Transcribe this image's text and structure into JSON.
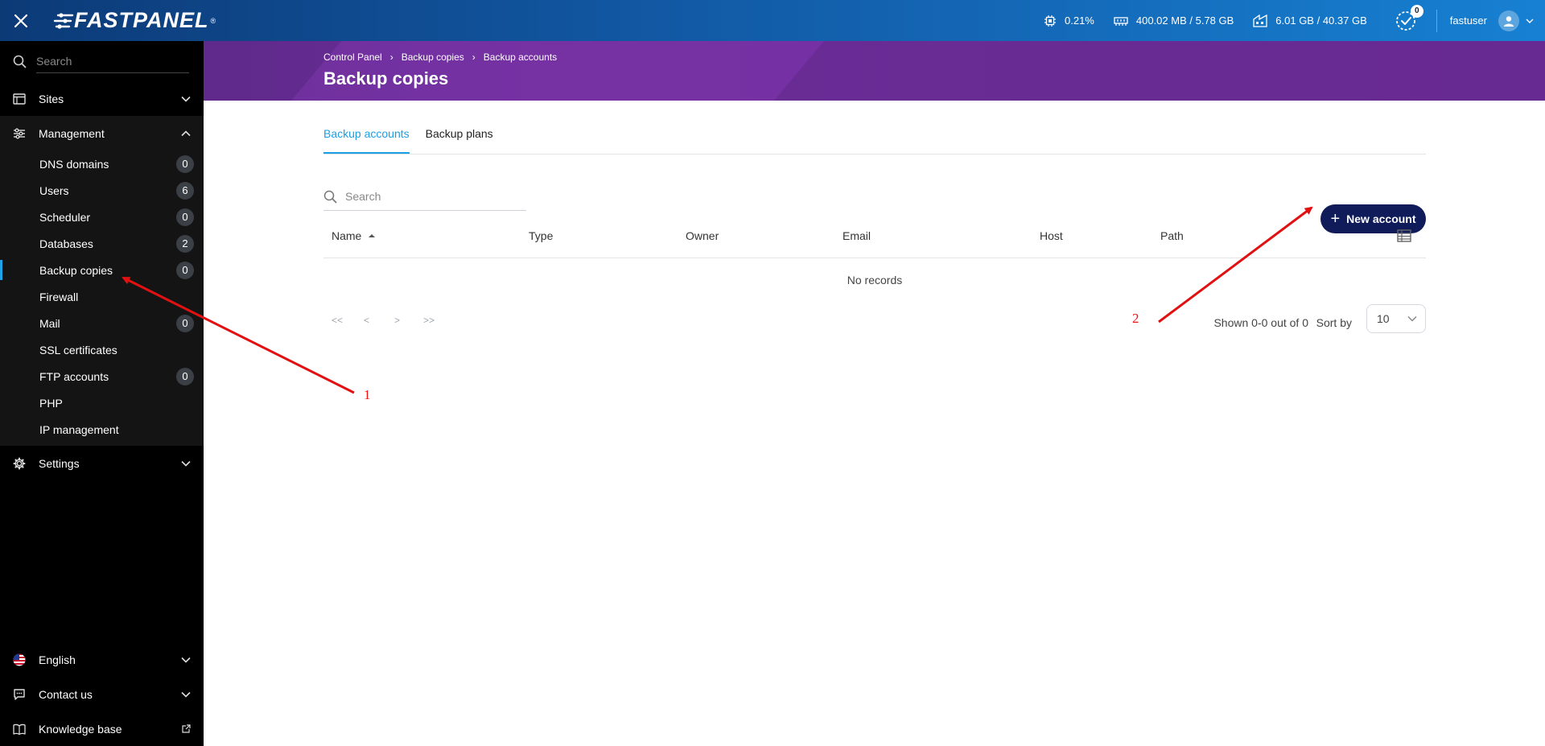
{
  "app": {
    "logo": "FASTPANEL",
    "logo_mark": "®"
  },
  "topbar": {
    "cpu": "0.21%",
    "ram": "400.02 MB / 5.78 GB",
    "disk": "6.01 GB / 40.37 GB",
    "tasks_count": "0",
    "username": "fastuser"
  },
  "sidebar": {
    "search_placeholder": "Search",
    "sites": "Sites",
    "management": "Management",
    "items": [
      {
        "label": "DNS domains",
        "count": "0"
      },
      {
        "label": "Users",
        "count": "6"
      },
      {
        "label": "Scheduler",
        "count": "0"
      },
      {
        "label": "Databases",
        "count": "2"
      },
      {
        "label": "Backup copies",
        "count": "0"
      },
      {
        "label": "Firewall"
      },
      {
        "label": "Mail",
        "count": "0"
      },
      {
        "label": "SSL certificates"
      },
      {
        "label": "FTP accounts",
        "count": "0"
      },
      {
        "label": "PHP"
      },
      {
        "label": "IP management"
      }
    ],
    "settings": "Settings",
    "language": "English",
    "contact": "Contact us",
    "knowledge": "Knowledge base"
  },
  "header": {
    "breadcrumb": [
      "Control Panel",
      "Backup copies",
      "Backup accounts"
    ],
    "title": "Backup copies"
  },
  "tabs": [
    "Backup accounts",
    "Backup plans"
  ],
  "toolbar": {
    "search_placeholder": "Search",
    "new_button": "New account"
  },
  "table": {
    "columns": [
      "Name",
      "Type",
      "Owner",
      "Email",
      "Host",
      "Path"
    ],
    "empty": "No records"
  },
  "pager": {
    "first": "<<",
    "prev": "<",
    "next": ">",
    "last": ">>",
    "shown": "Shown 0-0 out of 0",
    "sort_label": "Sort by",
    "per_page": "10"
  },
  "annotations": [
    "1",
    "2"
  ],
  "colors": {
    "accent": "#1b9ee2",
    "button": "#101c5a",
    "banner": "#6a2c96",
    "arrow": "#e11111"
  }
}
